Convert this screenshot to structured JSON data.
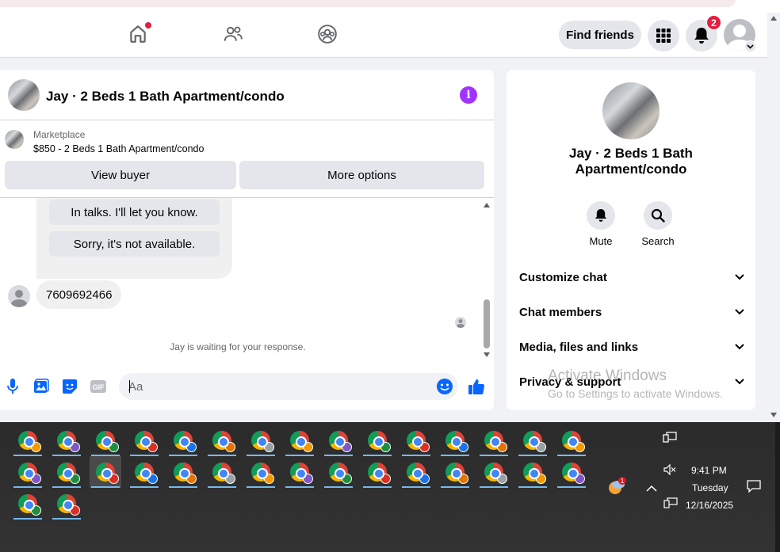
{
  "header": {
    "find_friends": "Find friends",
    "notification_count": "2"
  },
  "chat": {
    "title": "Jay · 2 Beds 1 Bath Apartment/condo",
    "marketplace_label": "Marketplace",
    "listing": "$850 - 2 Beds 1 Bath Apartment/condo",
    "view_buyer": "View buyer",
    "more_options": "More options",
    "quick_replies": [
      "In talks. I'll let you know.",
      "Sorry, it's not available."
    ],
    "message": "7609692466",
    "waiting": "Jay is waiting for your response.",
    "input_placeholder": "Aa"
  },
  "side_panel": {
    "title_line1": "Jay · 2 Beds 1 Bath",
    "title_line2": "Apartment/condo",
    "mute": "Mute",
    "search": "Search",
    "sections": [
      "Customize chat",
      "Chat members",
      "Media, files and links",
      "Privacy & support"
    ]
  },
  "watermark": {
    "line1": "Activate Windows",
    "line2": "Go to Settings to activate Windows."
  },
  "taskbar": {
    "time": "9:41 PM",
    "day": "Tuesday",
    "date": "12/16/2025",
    "weather_badge": "1"
  },
  "colors": {
    "accent": "#0866ff",
    "info": "#a033ff",
    "badge": "#e41e3f"
  }
}
